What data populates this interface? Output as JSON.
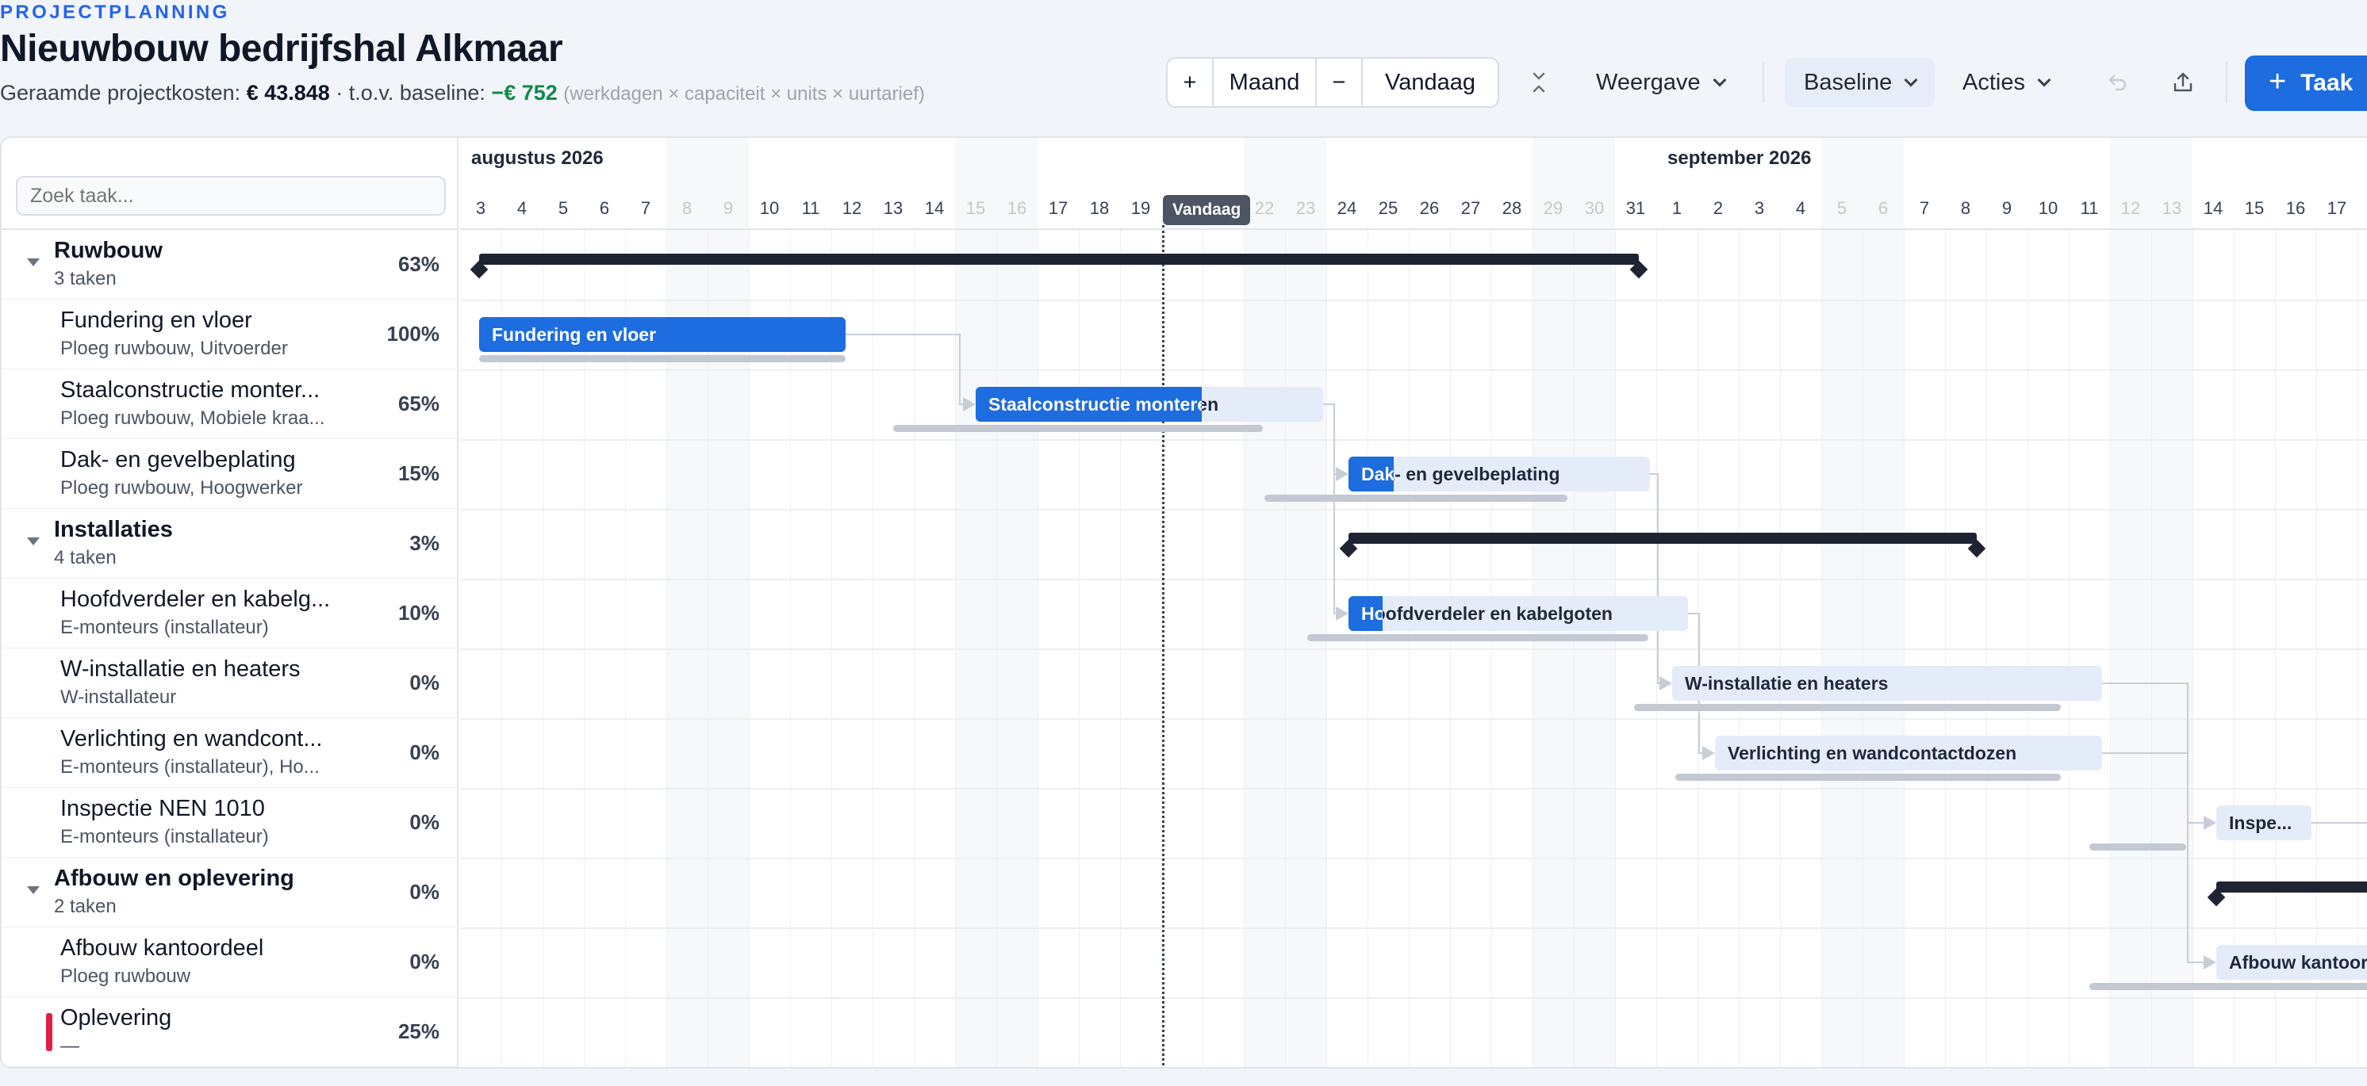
{
  "header": {
    "eyebrow": "PROJECTPLANNING",
    "title": "Nieuwbouw bedrijfshal Alkmaar",
    "cost_label": "Geraamde projectkosten:",
    "cost_value": "€ 43.848",
    "baseline_label": "· t.o.v. baseline:",
    "baseline_delta": "−€ 752",
    "formula": "(werkdagen × capaciteit × units × uurtarief)"
  },
  "toolbar": {
    "zoom_in": "+",
    "scale": "Maand",
    "zoom_out": "−",
    "today": "Vandaag",
    "view": "Weergave",
    "baseline": "Baseline",
    "actions": "Acties",
    "add_task": "Taak",
    "add_icon": "+"
  },
  "search": {
    "placeholder": "Zoek taak..."
  },
  "timeline": {
    "months": [
      {
        "label": "augustus 2026",
        "start_index": 0
      },
      {
        "label": "september 2026",
        "start_index": 29
      }
    ],
    "days": [
      "3",
      "4",
      "5",
      "6",
      "7",
      "8",
      "9",
      "10",
      "11",
      "12",
      "13",
      "14",
      "15",
      "16",
      "17",
      "18",
      "19",
      "20",
      "21",
      "22",
      "23",
      "24",
      "25",
      "26",
      "27",
      "28",
      "29",
      "30",
      "31",
      "1",
      "2",
      "3",
      "4",
      "5",
      "6",
      "7",
      "8",
      "9",
      "10",
      "11",
      "12",
      "13",
      "14",
      "15",
      "16",
      "17"
    ],
    "weekend_indices": [
      5,
      6,
      12,
      13,
      19,
      20,
      26,
      27,
      33,
      34,
      40,
      41
    ],
    "today_index": 17,
    "today_label": "Vandaag"
  },
  "tasks": [
    {
      "kind": "group",
      "name": "Ruwbouw",
      "sub": "3 taken",
      "pct": "63%"
    },
    {
      "kind": "task",
      "name": "Fundering en vloer",
      "sub": "Ploeg ruwbouw, Uitvoerder",
      "pct": "100%",
      "bar_label": "Fundering en vloer",
      "progress": 1.0
    },
    {
      "kind": "task",
      "name": "Staalconstructie monter...",
      "sub": "Ploeg ruwbouw, Mobiele kraa...",
      "pct": "65%",
      "bar_label": "Staalconstructie monteren",
      "progress": 0.65
    },
    {
      "kind": "task",
      "name": "Dak- en gevelbeplating",
      "sub": "Ploeg ruwbouw, Hoogwerker",
      "pct": "15%",
      "bar_label": "Dak- en gevelbeplating",
      "progress": 0.15
    },
    {
      "kind": "group",
      "name": "Installaties",
      "sub": "4 taken",
      "pct": "3%"
    },
    {
      "kind": "task",
      "name": "Hoofdverdeler en kabelg...",
      "sub": "E-monteurs (installateur)",
      "pct": "10%",
      "bar_label": "Hoofdverdeler en kabelgoten",
      "progress": 0.1
    },
    {
      "kind": "task",
      "name": "W-installatie en heaters",
      "sub": "W-installateur",
      "pct": "0%",
      "bar_label": "W-installatie en heaters",
      "progress": 0
    },
    {
      "kind": "task",
      "name": "Verlichting en wandcont...",
      "sub": "E-monteurs (installateur), Ho...",
      "pct": "0%",
      "bar_label": "Verlichting en wandcontactdozen",
      "progress": 0
    },
    {
      "kind": "task",
      "name": "Inspectie NEN 1010",
      "sub": "E-monteurs (installateur)",
      "pct": "0%",
      "bar_label": "Inspe...",
      "progress": 0
    },
    {
      "kind": "group",
      "name": "Afbouw en oplevering",
      "sub": "2 taken",
      "pct": "0%"
    },
    {
      "kind": "task",
      "name": "Afbouw kantoordeel",
      "sub": "Ploeg ruwbouw",
      "pct": "0%",
      "bar_label": "Afbouw kantoordeel",
      "progress": 0
    },
    {
      "kind": "milestone",
      "name": "Oplevering",
      "sub": "—",
      "pct": "25%"
    }
  ],
  "colors": {
    "accent": "#1d6ce0",
    "bar_bg": "#e4ecfa",
    "summary": "#1e2433",
    "baseline": "#c3c9d2",
    "milestone": "#e11d48",
    "delta_positive": "#0f8a4a"
  }
}
